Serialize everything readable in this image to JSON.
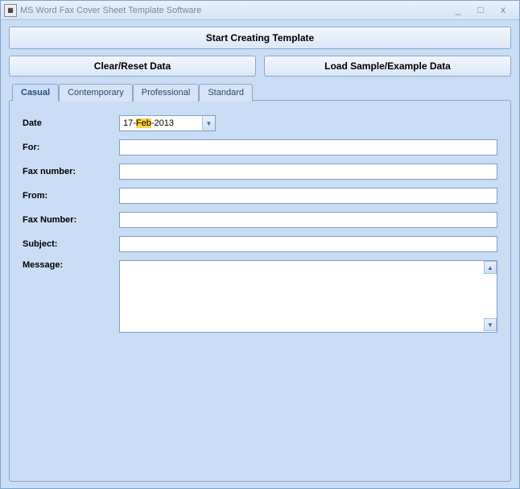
{
  "window": {
    "title": "MS Word Fax Cover Sheet Template Software"
  },
  "buttons": {
    "start": "Start Creating Template",
    "clear": "Clear/Reset Data",
    "load": "Load Sample/Example Data"
  },
  "tabs": [
    {
      "label": "Casual"
    },
    {
      "label": "Contemporary"
    },
    {
      "label": "Professional"
    },
    {
      "label": "Standard"
    }
  ],
  "form": {
    "date_label": "Date",
    "date_prefix": "17-",
    "date_highlight": "Feb",
    "date_suffix": "-2013",
    "for_label": "For:",
    "for_value": "",
    "faxnum1_label": "Fax number:",
    "faxnum1_value": "",
    "from_label": "From:",
    "from_value": "",
    "faxnum2_label": "Fax Number:",
    "faxnum2_value": "",
    "subject_label": "Subject:",
    "subject_value": "",
    "message_label": "Message:",
    "message_value": ""
  }
}
